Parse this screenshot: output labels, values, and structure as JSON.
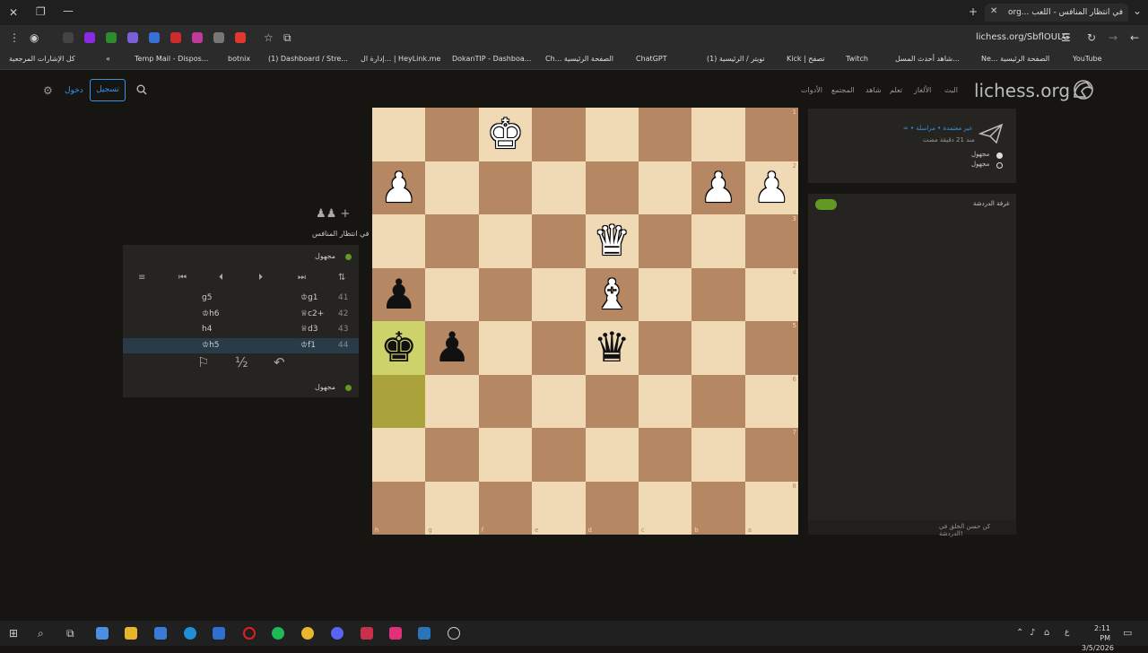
{
  "browser": {
    "tab_title": "في انتظار المنافس - اللعب ...org",
    "url": "lichess.org/SbflOULG",
    "bookmarks": [
      "كل الإشارات المرجعية",
      "Temp Mail - Dispos...",
      "botnix",
      "(1) Dashboard / Stre...",
      "إدارة ال... | HeyLink.me",
      "DokanTIP - Dashboa...",
      "Ch... الصفحة الرئيسية",
      "ChatGPT",
      "(1) تويتر / الرئيسية",
      "Kick | تصفح",
      "Twitch",
      "شاهد أحدث المسل...",
      "Ne... الصفحة الرئيسية",
      "YouTube"
    ]
  },
  "site": {
    "logo": "lichess.org",
    "nav": [
      "البث",
      "الألغاز",
      "تعلم",
      "شاهد",
      "المجتمع",
      "الأدوات"
    ],
    "signin_label": "تسجيل",
    "register_label": "دخول"
  },
  "board": {
    "files_bottom": [
      "h",
      "g",
      "f",
      "e",
      "d",
      "c",
      "b",
      "a"
    ],
    "ranks_right": [
      "1",
      "2",
      "3",
      "4",
      "5",
      "6",
      "7",
      "8"
    ],
    "highlight_squares": [
      [
        4,
        0
      ],
      [
        5,
        0
      ]
    ],
    "pieces": [
      {
        "r": 0,
        "c": 2,
        "g": "♚",
        "color": "w"
      },
      {
        "r": 1,
        "c": 0,
        "g": "♟",
        "color": "w"
      },
      {
        "r": 1,
        "c": 6,
        "g": "♟",
        "color": "w"
      },
      {
        "r": 1,
        "c": 7,
        "g": "♟",
        "color": "w"
      },
      {
        "r": 2,
        "c": 4,
        "g": "♛",
        "color": "w"
      },
      {
        "r": 3,
        "c": 0,
        "g": "♟",
        "color": "b"
      },
      {
        "r": 3,
        "c": 4,
        "g": "♝",
        "color": "w"
      },
      {
        "r": 4,
        "c": 0,
        "g": "♚",
        "color": "b"
      },
      {
        "r": 4,
        "c": 1,
        "g": "♟",
        "color": "b"
      },
      {
        "r": 4,
        "c": 4,
        "g": "♛",
        "color": "b"
      }
    ]
  },
  "left": {
    "status": "في انتظار المنافس",
    "top_player": "مجهول",
    "bottom_player": "مجهول",
    "captured": "♟♟ +",
    "moves": [
      {
        "no": "41",
        "white": "♔g1",
        "black": "g5"
      },
      {
        "no": "42",
        "white": "♕c2+",
        "black": "♔h6"
      },
      {
        "no": "43",
        "white": "♕d3",
        "black": "h4"
      },
      {
        "no": "44",
        "white": "♔f1",
        "black": "♔h5"
      }
    ]
  },
  "right": {
    "game_info": "∞ • غير معتمدة • مراسلة",
    "game_time": "منذ 21 دقيقة مضت",
    "player_white": "مجهول",
    "player_black": "مجهول",
    "chat_label": "غرفة الدردشة",
    "chat_footer": "كن حسن الخلق في الدردشة!"
  },
  "taskbar": {
    "time": "2:11 PM",
    "date": "3/5/2026",
    "lang": "ع"
  }
}
